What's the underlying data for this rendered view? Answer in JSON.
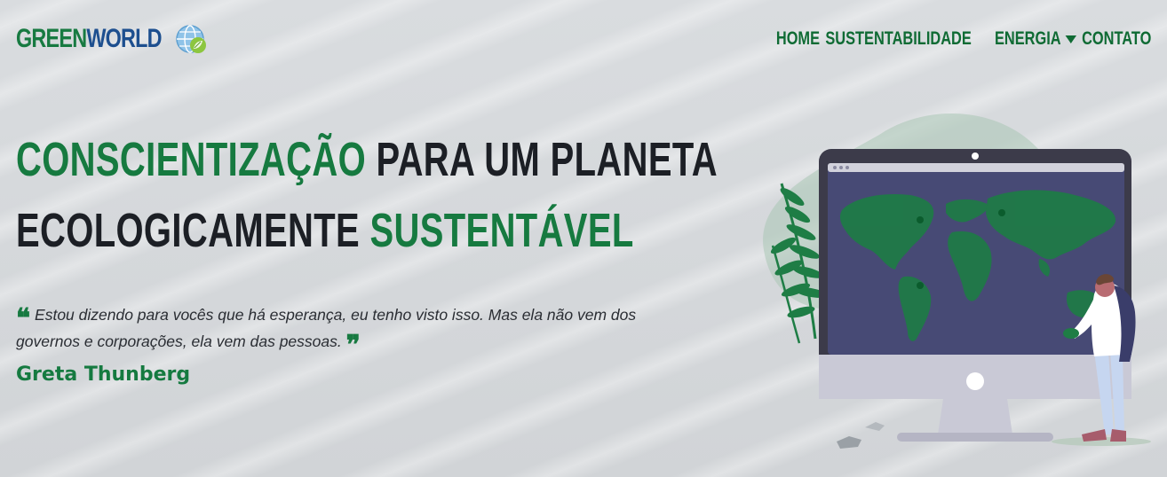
{
  "brand": {
    "part1": "GREEN",
    "part2": "WORLD",
    "icon": "globe-leaf-icon",
    "green": "#177a41",
    "blue": "#1d4f8f"
  },
  "nav": {
    "items": [
      {
        "label": "HOME"
      },
      {
        "label": "SUSTENTABILIDADE"
      },
      {
        "label": "ENERGIA",
        "has_dropdown": true
      },
      {
        "label": "CONTATO"
      }
    ]
  },
  "hero": {
    "title_part1": "CONSCIENTIZAÇÃO",
    "title_part2": " PARA UM PLANETA",
    "title_part3": "ECOLOGICAMENTE ",
    "title_part4": "SUSTENTÁVEL",
    "quote": "Estou dizendo para vocês que há esperança, eu tenho visto isso. Mas ela não vem dos governos e corporações, ela vem das pessoas.",
    "quote_open": "❝",
    "quote_close": "❞",
    "author": "Greta Thunberg"
  },
  "colors": {
    "accent": "#167a40",
    "dark_text": "#1c1f25",
    "screen": "#474a75",
    "monitor_frame": "#3c3b4a"
  }
}
